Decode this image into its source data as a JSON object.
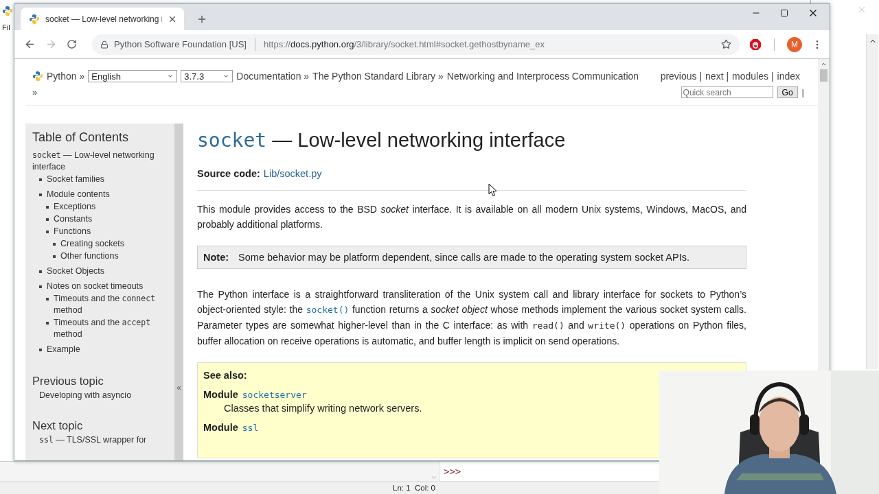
{
  "back_window_left": {
    "menu": "Fil"
  },
  "browser": {
    "tab": {
      "title": "socket — Low-level networking i"
    },
    "address": {
      "site": "Python Software Foundation [US]",
      "scheme": "https://",
      "host": "docs.python.org",
      "path": "/3/library/socket.html#socket.gethostbyname_ex"
    },
    "profile_initial": "M"
  },
  "page": {
    "nav": {
      "home": "Python »",
      "language": "English",
      "version": "3.7.3",
      "breadcrumbs": [
        "Documentation »",
        "The Python Standard Library »",
        "Networking and Interprocess Communication"
      ],
      "links": [
        "previous |",
        "next |",
        "modules |",
        "index"
      ],
      "trailing": "»",
      "search": {
        "placeholder": "Quick search",
        "button": "Go"
      },
      "search_separator": "|"
    },
    "sidebar": {
      "title": "Table of Contents",
      "collapse": "«",
      "toc": [
        {
          "segments": [
            {
              "kind": "code",
              "value": "socket"
            },
            {
              "kind": "text",
              "value": " — Low-level networking interface"
            }
          ],
          "children": [
            {
              "text": "Socket families"
            },
            {
              "text": "Module contents",
              "children": [
                {
                  "text": "Exceptions"
                },
                {
                  "text": "Constants"
                },
                {
                  "text": "Functions",
                  "children": [
                    {
                      "text": "Creating sockets"
                    },
                    {
                      "text": "Other functions"
                    }
                  ]
                }
              ]
            },
            {
              "text": "Socket Objects"
            },
            {
              "text": "Notes on socket timeouts",
              "children": [
                {
                  "segments": [
                    {
                      "kind": "text",
                      "value": "Timeouts and the "
                    },
                    {
                      "kind": "code",
                      "value": "connect"
                    },
                    {
                      "kind": "text",
                      "value": " method"
                    }
                  ]
                },
                {
                  "segments": [
                    {
                      "kind": "text",
                      "value": "Timeouts and the "
                    },
                    {
                      "kind": "code",
                      "value": "accept"
                    },
                    {
                      "kind": "text",
                      "value": " method"
                    }
                  ]
                }
              ]
            },
            {
              "text": "Example"
            }
          ]
        }
      ],
      "previous": {
        "heading": "Previous topic",
        "link": [
          {
            "kind": "text",
            "value": "Developing with asyncio"
          }
        ]
      },
      "next": {
        "heading": "Next topic",
        "link": [
          {
            "kind": "code",
            "value": "ssl"
          },
          {
            "kind": "text",
            "value": " — TLS/SSL wrapper for"
          }
        ]
      }
    },
    "main": {
      "title": [
        {
          "kind": "code",
          "value": "socket"
        },
        {
          "kind": "text",
          "value": " — Low-level networking interface"
        }
      ],
      "source": {
        "label": "Source code:",
        "link": "Lib/socket.py"
      },
      "paragraphs": [
        [
          {
            "kind": "text",
            "value": "This module provides access to the BSD "
          },
          {
            "kind": "em",
            "value": "socket"
          },
          {
            "kind": "text",
            "value": " interface. It is available on all modern Unix systems, Windows, MacOS, and probably additional platforms."
          }
        ],
        [
          {
            "kind": "text",
            "value": "The Python interface is a straightforward transliteration of the Unix system call and library interface for sockets to Python’s object-oriented style: the "
          },
          {
            "kind": "codelink",
            "value": "socket()"
          },
          {
            "kind": "text",
            "value": " function returns a "
          },
          {
            "kind": "em",
            "value": "socket object"
          },
          {
            "kind": "text",
            "value": " whose methods implement the various socket system calls. Parameter types are somewhat higher-level than in the C interface: as with "
          },
          {
            "kind": "code",
            "value": "read()"
          },
          {
            "kind": "text",
            "value": " and "
          },
          {
            "kind": "code",
            "value": "write()"
          },
          {
            "kind": "text",
            "value": " operations on Python files, buffer allocation on receive operations is automatic, and buffer length is implicit on send operations."
          }
        ]
      ],
      "note": {
        "label": "Note:",
        "text": "Some behavior may be platform dependent, since calls are made to the operating system socket APIs."
      },
      "see_also": {
        "title": "See also:",
        "entries": [
          {
            "label": "Module",
            "name": "socketserver",
            "description": "Classes that simplify writing network servers."
          },
          {
            "label": "Module",
            "name": "ssl"
          }
        ]
      }
    }
  },
  "shell": {
    "prompt": ">>>",
    "status": "Ln: 1  Col: 0"
  }
}
